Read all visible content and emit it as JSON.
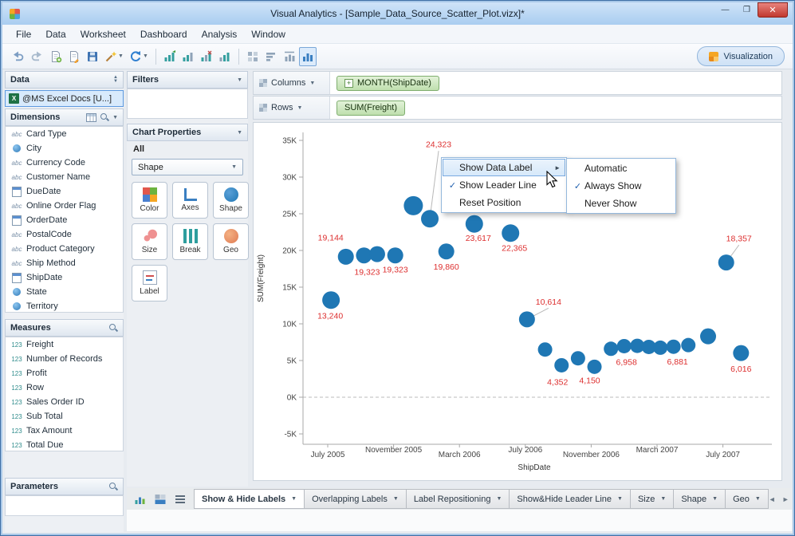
{
  "window": {
    "title": "Visual Analytics - [Sample_Data_Source_Scatter_Plot.vizx]*",
    "controls": {
      "minimize": "—",
      "maximize": "❐",
      "close": "✕"
    }
  },
  "menu": {
    "items": [
      "File",
      "Data",
      "Worksheet",
      "Dashboard",
      "Analysis",
      "Window"
    ]
  },
  "toolbar": {
    "visualization_label": "Visualization",
    "icon_names": [
      "undo",
      "redo",
      "new-worksheet",
      "add-data",
      "save",
      "format-wand",
      "refresh-data",
      "insert-chart",
      "chart-grid",
      "chart-clear",
      "chart-plain",
      "grid-view",
      "sort-bars",
      "fit-chart",
      "active-chart-view"
    ]
  },
  "data_panel": {
    "title": "Data",
    "source": {
      "label": "@MS Excel Docs [U...]"
    },
    "dimensions": {
      "title": "Dimensions",
      "items": [
        {
          "label": "Card Type",
          "icon": "abc"
        },
        {
          "label": "City",
          "icon": "globe"
        },
        {
          "label": "Currency Code",
          "icon": "abc"
        },
        {
          "label": "Customer Name",
          "icon": "abc"
        },
        {
          "label": "DueDate",
          "icon": "date"
        },
        {
          "label": "Online Order Flag",
          "icon": "abc"
        },
        {
          "label": "OrderDate",
          "icon": "date"
        },
        {
          "label": "PostalCode",
          "icon": "abc"
        },
        {
          "label": "Product Category",
          "icon": "abc"
        },
        {
          "label": "Ship Method",
          "icon": "abc"
        },
        {
          "label": "ShipDate",
          "icon": "date"
        },
        {
          "label": "State",
          "icon": "globe"
        },
        {
          "label": "Territory",
          "icon": "globe"
        }
      ]
    },
    "measures": {
      "title": "Measures",
      "items": [
        {
          "label": "Freight",
          "icon": "num"
        },
        {
          "label": "Number of Records",
          "icon": "num"
        },
        {
          "label": "Profit",
          "icon": "num"
        },
        {
          "label": "Row",
          "icon": "num"
        },
        {
          "label": "Sales Order ID",
          "icon": "num"
        },
        {
          "label": "Sub Total",
          "icon": "num"
        },
        {
          "label": "Tax Amount",
          "icon": "num"
        },
        {
          "label": "Total Due",
          "icon": "num"
        }
      ]
    },
    "parameters": {
      "title": "Parameters"
    }
  },
  "filters_panel": {
    "title": "Filters"
  },
  "chart_properties": {
    "title": "Chart Properties",
    "scope_label": "All",
    "selector_value": "Shape",
    "buttons": [
      {
        "label": "Color",
        "icon": "color"
      },
      {
        "label": "Axes",
        "icon": "axes"
      },
      {
        "label": "Shape",
        "icon": "shape"
      },
      {
        "label": "Size",
        "icon": "size"
      },
      {
        "label": "Break",
        "icon": "break"
      },
      {
        "label": "Geo",
        "icon": "geo"
      },
      {
        "label": "Label",
        "icon": "label"
      }
    ]
  },
  "shelves": {
    "columns": {
      "label": "Columns",
      "pill": "MONTH(ShipDate)"
    },
    "rows": {
      "label": "Rows",
      "pill": "SUM(Freight)"
    }
  },
  "context_menu": {
    "items": [
      {
        "label": "Show Data Label",
        "submenu": true,
        "highlighted": true
      },
      {
        "label": "Show Leader Line",
        "checked": true
      },
      {
        "label": "Reset Position"
      }
    ],
    "submenu": [
      {
        "label": "Automatic"
      },
      {
        "label": "Always Show",
        "checked": true
      },
      {
        "label": "Never Show"
      }
    ]
  },
  "chart_data": {
    "type": "scatter",
    "xlabel": "ShipDate",
    "ylabel": "SUM(Freight)",
    "ylim": [
      -7500,
      37500
    ],
    "grid": "zero-line-dashed",
    "point_color": "#1f77b4",
    "label_color": "#dd2f2f",
    "x_ticks": [
      {
        "m": 0,
        "label": "July 2005"
      },
      {
        "m": 4,
        "label": "November 2005"
      },
      {
        "m": 8,
        "label": "March 2006"
      },
      {
        "m": 12,
        "label": "July 2006"
      },
      {
        "m": 16,
        "label": "November 2006"
      },
      {
        "m": 20,
        "label": "March 2007"
      },
      {
        "m": 24,
        "label": "July 2007"
      }
    ],
    "y_ticks": [
      {
        "v": 35000,
        "label": "35K"
      },
      {
        "v": 30000,
        "label": "30K"
      },
      {
        "v": 25000,
        "label": "25K"
      },
      {
        "v": 20000,
        "label": "20K"
      },
      {
        "v": 15000,
        "label": "15K"
      },
      {
        "v": 10000,
        "label": "10K"
      },
      {
        "v": 5000,
        "label": "5K"
      },
      {
        "v": 0,
        "label": "0K"
      },
      {
        "v": -5000,
        "label": "-5K"
      }
    ],
    "points": [
      {
        "m": 0.2,
        "v": 13240,
        "r": 11,
        "label": "13,240",
        "dx": -1,
        "dy": 20
      },
      {
        "m": 1.1,
        "v": 19144,
        "r": 10,
        "label": "19,144",
        "dx": -19,
        "dy": -24
      },
      {
        "m": 2.2,
        "v": 19323,
        "r": 10,
        "label": "19,323",
        "dx": 4,
        "dy": 21
      },
      {
        "m": 3.0,
        "v": 19500,
        "r": 10
      },
      {
        "m": 4.1,
        "v": 19323,
        "r": 10,
        "label": "19,323",
        "dx": 0,
        "dy": 18
      },
      {
        "m": 5.2,
        "v": 26100,
        "r": 12
      },
      {
        "m": 6.2,
        "v": 24323,
        "r": 11,
        "label": "24,323",
        "dx": 11,
        "dy": -93,
        "leader": true
      },
      {
        "m": 7.2,
        "v": 19860,
        "r": 10,
        "label": "19,860",
        "dx": 0,
        "dy": 19
      },
      {
        "m": 8.9,
        "v": 23617,
        "r": 11,
        "label": "23,617",
        "dx": 5,
        "dy": 18
      },
      {
        "m": 11.1,
        "v": 22365,
        "r": 11,
        "label": "22,365",
        "dx": 5,
        "dy": 19
      },
      {
        "m": 12.1,
        "v": 10614,
        "r": 10,
        "label": "10,614",
        "dx": 27,
        "dy": -22,
        "leader": true
      },
      {
        "m": 13.2,
        "v": 6500,
        "r": 9
      },
      {
        "m": 14.2,
        "v": 4352,
        "r": 9,
        "label": "4,352",
        "dx": -5,
        "dy": 21
      },
      {
        "m": 15.2,
        "v": 5300,
        "r": 9
      },
      {
        "m": 16.2,
        "v": 4150,
        "r": 9,
        "label": "4,150",
        "dx": -6,
        "dy": 17
      },
      {
        "m": 17.2,
        "v": 6600,
        "r": 9
      },
      {
        "m": 18.0,
        "v": 6958,
        "r": 9,
        "label": "6,958",
        "dx": 3,
        "dy": 20
      },
      {
        "m": 18.8,
        "v": 7000,
        "r": 9
      },
      {
        "m": 19.5,
        "v": 6850,
        "r": 9
      },
      {
        "m": 20.2,
        "v": 6750,
        "r": 9
      },
      {
        "m": 21.0,
        "v": 6881,
        "r": 9,
        "label": "6,881",
        "dx": 5,
        "dy": 19
      },
      {
        "m": 21.9,
        "v": 7100,
        "r": 9
      },
      {
        "m": 23.1,
        "v": 8300,
        "r": 10
      },
      {
        "m": 24.2,
        "v": 18357,
        "r": 10,
        "label": "18,357",
        "dx": 16,
        "dy": -30,
        "leader": true
      },
      {
        "m": 25.1,
        "v": 6016,
        "r": 10,
        "label": "6,016",
        "dx": 0,
        "dy": 20
      }
    ]
  },
  "bottom_tabs": {
    "tabs": [
      {
        "label": "Show & Hide Labels",
        "active": true
      },
      {
        "label": "Overlapping Labels"
      },
      {
        "label": "Label Repositioning"
      },
      {
        "label": "Show&Hide Leader Line"
      },
      {
        "label": "Size"
      },
      {
        "label": "Shape"
      },
      {
        "label": "Geo"
      }
    ]
  }
}
